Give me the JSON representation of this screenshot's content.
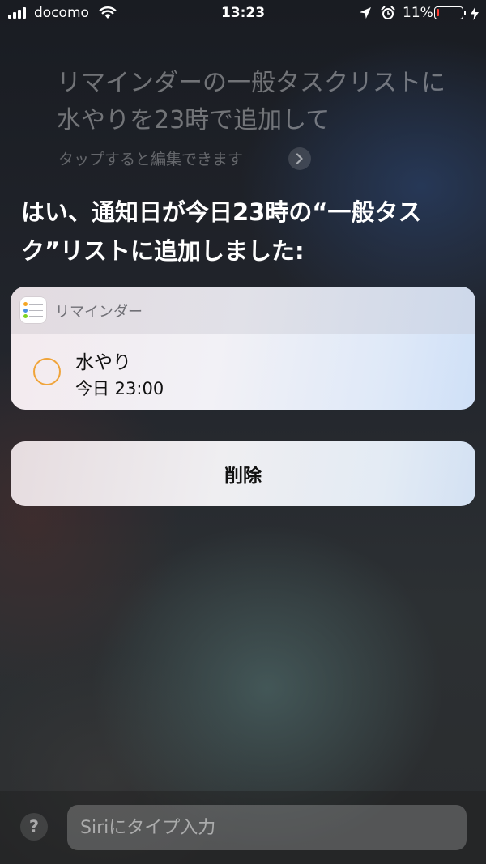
{
  "status_bar": {
    "carrier": "docomo",
    "time": "13:23",
    "battery_percent": "11%",
    "battery_level": 0.11,
    "battery_color": "#ff3b30"
  },
  "query": {
    "text": "リマインダーの一般タスクリストに水やりを23時で追加して",
    "edit_hint": "タップすると編集できます"
  },
  "response": {
    "text": "はい、通知日が今日23時の“一般タスク”リストに追加しました:"
  },
  "reminder_card": {
    "app_name": "リマインダー",
    "title": "水やり",
    "due": "今日 23:00",
    "circle_color": "#f0a43a"
  },
  "delete_button": {
    "label": "削除"
  },
  "bottom_bar": {
    "help_label": "?",
    "input_placeholder": "Siriにタイプ入力"
  }
}
